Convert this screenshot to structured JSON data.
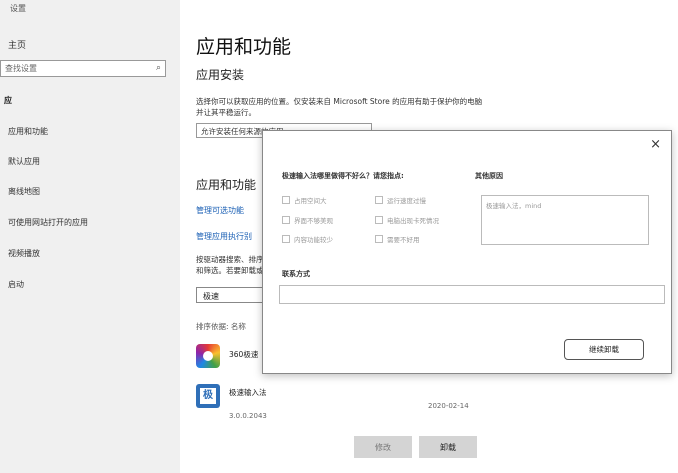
{
  "sidebar": {
    "window_title": "设置",
    "home": "主页",
    "search_placeholder": "查找设置",
    "section": "应",
    "items": [
      "应用和功能",
      "默认应用",
      "离线地图",
      "可使用网站打开的应用",
      "视频播放",
      "启动"
    ]
  },
  "main": {
    "title": "应用和功能",
    "install_heading": "应用安装",
    "install_desc": "选择你可以获取应用的位置。仅安装来自 Microsoft Store 的应用有助于保护你的电脑并让其平稳运行。",
    "install_select": "允许安装任何来源的应用",
    "features_heading": "应用和功能",
    "link_optional": "管理可选功能",
    "link_alias": "管理应用执行别",
    "search_desc": "按驱动器搜索、排序和筛选。若要卸载或移动某个应用，请从列表中选择它。",
    "filter_value": "极速",
    "sort_label": "排序依据: 名称",
    "apps": [
      {
        "name": "360极速",
        "icon": "browser-icon"
      },
      {
        "name": "极速输入法",
        "icon": "ime-icon",
        "icon_glyph": "极",
        "version": "3.0.0.2043",
        "date": "2020-02-14"
      }
    ],
    "btn_modify": "修改",
    "btn_uninstall": "卸载"
  },
  "dialog": {
    "close": "×",
    "question": "极速输入法哪里做得不好么？请您指点:",
    "options_left": [
      "占用空间大",
      "界面不够美观",
      "内容功能较少"
    ],
    "options_right": [
      "运行速度过慢",
      "电脑出现卡死情况",
      "需要不好用"
    ],
    "other_label": "其他原因",
    "other_placeholder": "极速输入法，mind",
    "contact_label": "联系方式",
    "submit": "继续卸载"
  },
  "colors": {
    "accent_link": "#1a5fb4",
    "sidebar_bg": "#f0f0f0"
  }
}
